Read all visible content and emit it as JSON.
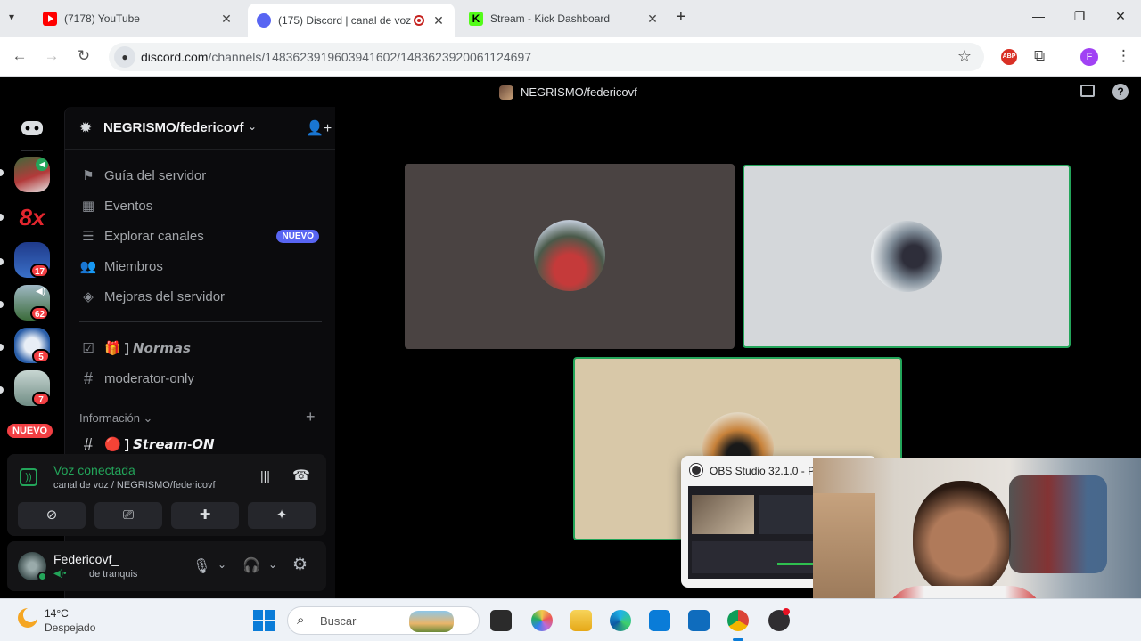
{
  "browser": {
    "tabs": [
      {
        "title": "(7178) YouTube",
        "favicon": "youtube-icon",
        "color": "#ff0000"
      },
      {
        "title": "(175) Discord | canal de voz",
        "favicon": "discord-icon",
        "color": "#5865f2",
        "active": true
      },
      {
        "title": "Stream - Kick Dashboard",
        "favicon": "kick-icon",
        "color": "#53fc18"
      }
    ],
    "url_host": "discord.com",
    "url_path": "/channels/1483623919603941602/1483623920061124697",
    "profile_initial": "F",
    "abp_label": "ABP"
  },
  "discord": {
    "window_title": "NEGRISMO/federicovf",
    "server_name": "NEGRISMO/federicovf",
    "servers": [
      {
        "name": "server-voice",
        "colors": [
          "#4a6a3a",
          "#c23a3a"
        ]
      },
      {
        "name": "server-8x",
        "label": "8x"
      },
      {
        "name": "server-3",
        "badge": "17"
      },
      {
        "name": "server-4",
        "badge": "62"
      },
      {
        "name": "server-5",
        "badge": "5"
      },
      {
        "name": "server-6",
        "badge": "7"
      }
    ],
    "rail_new_label": "NUEVO",
    "nav": [
      {
        "label": "Guía del servidor",
        "icon": "signpost-icon"
      },
      {
        "label": "Eventos",
        "icon": "calendar-icon"
      },
      {
        "label": "Explorar canales",
        "icon": "list-icon",
        "pill": "NUEVO"
      },
      {
        "label": "Miembros",
        "icon": "members-icon"
      },
      {
        "label": "Mejoras del servidor",
        "icon": "boost-icon"
      }
    ],
    "channels": [
      {
        "label": "🎁 ] 𝙉𝙤𝙧𝙢𝙖𝙨",
        "icon": "rules-icon"
      },
      {
        "label": "moderator-only",
        "icon": "hash-icon"
      }
    ],
    "category": "Información",
    "stream_channel": "🔴 ] 𝙎𝙩𝙧𝙚𝙖𝙢-𝙊𝙉",
    "voice": {
      "status": "Voz conectada",
      "channel": "canal de voz / NEGRISMO/federicovf"
    },
    "user": {
      "name": "Federicovf_",
      "status": "de tranquis"
    }
  },
  "obs": {
    "title": "OBS Studio 32.1.0 - Pe"
  },
  "taskbar": {
    "weather_temp": "14°C",
    "weather_desc": "Despejado",
    "search_placeholder": "Buscar"
  }
}
